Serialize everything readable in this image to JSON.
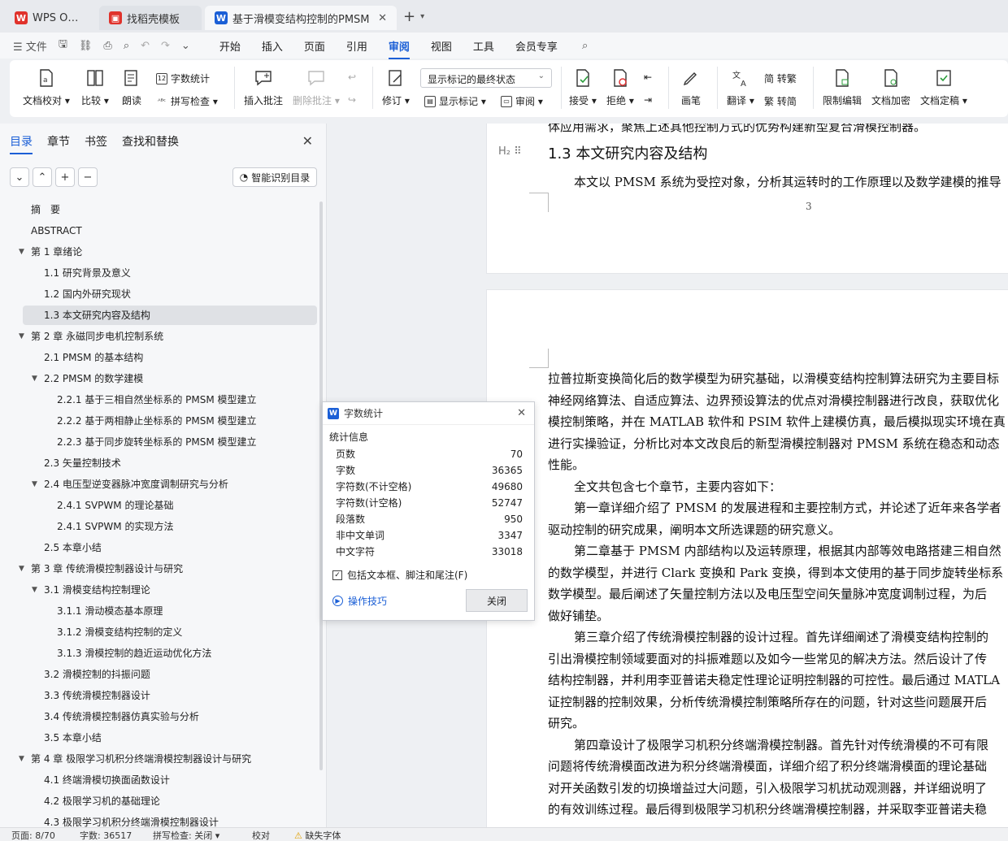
{
  "tabs": [
    {
      "label": "WPS Office",
      "color": "#e0322b"
    },
    {
      "label": "找稻壳模板",
      "color": "#e0322b"
    },
    {
      "label": "基于滑模变结构控制的PMSM",
      "color": "#1b5fd6"
    }
  ],
  "menu": {
    "file": "文件",
    "items": [
      "开始",
      "插入",
      "页面",
      "引用",
      "审阅",
      "视图",
      "工具",
      "会员专享"
    ],
    "active": "审阅"
  },
  "ribbon": {
    "doc_check": "文档校对",
    "compare": "比较",
    "read_aloud": "朗读",
    "word_count": "字数统计",
    "spell_check": "拼写检查",
    "insert_comment": "插入批注",
    "delete_comment": "删除批注",
    "revise": "修订",
    "markup_state": "显示标记的最终状态",
    "show_markup": "显示标记",
    "review": "审阅",
    "accept": "接受",
    "reject": "拒绝",
    "pen": "画笔",
    "translate": "翻译",
    "to_traditional": "简 转繁",
    "to_simplified": "繁 转简",
    "restrict_edit": "限制编辑",
    "encrypt": "文档加密",
    "finalize": "文档定稿"
  },
  "nav": {
    "tabs": [
      "目录",
      "章节",
      "书签",
      "查找和替换"
    ],
    "smart_toc": "智能识别目录",
    "toc": [
      {
        "label": "摘　要",
        "level": 0,
        "caret": false
      },
      {
        "label": "ABSTRACT",
        "level": 0,
        "caret": false
      },
      {
        "label": "第 1 章绪论",
        "level": 0,
        "caret": true
      },
      {
        "label": "1.1  研究背景及意义",
        "level": 1,
        "caret": false
      },
      {
        "label": "1.2  国内外研究现状",
        "level": 1,
        "caret": false
      },
      {
        "label": "1.3  本文研究内容及结构",
        "level": 1,
        "caret": false,
        "selected": true
      },
      {
        "label": "第 2 章  永磁同步电机控制系统",
        "level": 0,
        "caret": true
      },
      {
        "label": "2.1 PMSM 的基本结构",
        "level": 1,
        "caret": false
      },
      {
        "label": "2.2 PMSM 的数学建模",
        "level": 1,
        "caret": true
      },
      {
        "label": "2.2.1  基于三相自然坐标系的 PMSM 模型建立",
        "level": 2,
        "caret": false
      },
      {
        "label": "2.2.2  基于两相静止坐标系的 PMSM 模型建立",
        "level": 2,
        "caret": false
      },
      {
        "label": "2.2.3  基于同步旋转坐标系的 PMSM 模型建立",
        "level": 2,
        "caret": false
      },
      {
        "label": "2.3  矢量控制技术",
        "level": 1,
        "caret": false
      },
      {
        "label": "2.4  电压型逆变器脉冲宽度调制研究与分析",
        "level": 1,
        "caret": true
      },
      {
        "label": "2.4.1 SVPWM 的理论基础",
        "level": 2,
        "caret": false
      },
      {
        "label": "2.4.1 SVPWM 的实现方法",
        "level": 2,
        "caret": false
      },
      {
        "label": "2.5  本章小结",
        "level": 1,
        "caret": false
      },
      {
        "label": "第 3 章  传统滑模控制器设计与研究",
        "level": 0,
        "caret": true
      },
      {
        "label": "3.1  滑模变结构控制理论",
        "level": 1,
        "caret": true
      },
      {
        "label": "3.1.1  滑动模态基本原理",
        "level": 2,
        "caret": false
      },
      {
        "label": "3.1.2  滑模变结构控制的定义",
        "level": 2,
        "caret": false
      },
      {
        "label": "3.1.3  滑模控制的趋近运动优化方法",
        "level": 2,
        "caret": false
      },
      {
        "label": "3.2  滑模控制的抖振问题",
        "level": 1,
        "caret": false
      },
      {
        "label": "3.3  传统滑模控制器设计",
        "level": 1,
        "caret": false
      },
      {
        "label": "3.4  传统滑模控制器仿真实验与分析",
        "level": 1,
        "caret": false
      },
      {
        "label": "3.5  本章小结",
        "level": 1,
        "caret": false
      },
      {
        "label": "第 4 章  极限学习机积分终端滑模控制器设计与研究",
        "level": 0,
        "caret": true
      },
      {
        "label": "4.1  终端滑模切换面函数设计",
        "level": 1,
        "caret": false
      },
      {
        "label": "4.2  极限学习机的基础理论",
        "level": 1,
        "caret": false
      },
      {
        "label": "4.3  极限学习机积分终端滑模控制器设计",
        "level": 1,
        "caret": false
      }
    ]
  },
  "document": {
    "page1_top_line": "体应用需求，聚焦上述其他控制方式的优势构建新型复合滑模控制器。",
    "heading": "1.3  本文研究内容及结构",
    "page1_para": "本文以 PMSM 系统为受控对象，分析其运转时的工作原理以及数学建模的推导",
    "page_number": "3",
    "page2_lines": [
      "拉普拉斯变换简化后的数学模型为研究基础，以滑模变结构控制算法研究为主要目标",
      "神经网络算法、自适应算法、边界预设算法的优点对滑模控制器进行改良，获取优化",
      "模控制策略，并在 MATLAB 软件和 PSIM 软件上建模仿真，最后模拟现实环境在真",
      "进行实操验证，分析比对本文改良后的新型滑模控制器对 PMSM 系统在稳态和动态",
      "性能。",
      "全文共包含七个章节，主要内容如下：",
      "第一章详细介绍了 PMSM 的发展进程和主要控制方式，并论述了近年来各学者",
      "驱动控制的研究成果，阐明本文所选课题的研究意义。",
      "第二章基于 PMSM 内部结构以及运转原理，根据其内部等效电路搭建三相自然",
      "的数学模型，并进行 Clark 变换和 Park 变换，得到本文使用的基于同步旋转坐标系",
      "数学模型。最后阐述了矢量控制方法以及电压型空间矢量脉冲宽度调制过程，为后",
      "做好铺垫。",
      "第三章介绍了传统滑模控制器的设计过程。首先详细阐述了滑模变结构控制的",
      "引出滑模控制领域要面对的抖振难题以及如今一些常见的解决方法。然后设计了传",
      "结构控制器，并利用李亚普诺夫稳定性理论证明控制器的可控性。最后通过 MATLA",
      "证控制器的控制效果，分析传统滑模控制策略所存在的问题，针对这些问题展开后",
      "研究。",
      "第四章设计了极限学习机积分终端滑模控制器。首先针对传统滑模的不可有限",
      "问题将传统滑模面改进为积分终端滑模面，详细介绍了积分终端滑模面的理论基础",
      "对开关函数引发的切换增益过大问题，引入极限学习机扰动观测器，并详细说明了",
      "的有效训练过程。最后得到极限学习机积分终端滑模控制器，并采取李亚普诺夫稳"
    ],
    "indent_lines": [
      5,
      6,
      8,
      12,
      17
    ]
  },
  "word_count_dialog": {
    "title": "字数统计",
    "section": "统计信息",
    "stats": [
      {
        "label": "页数",
        "value": "70"
      },
      {
        "label": "字数",
        "value": "36365"
      },
      {
        "label": "字符数(不计空格)",
        "value": "49680"
      },
      {
        "label": "字符数(计空格)",
        "value": "52747"
      },
      {
        "label": "段落数",
        "value": "950"
      },
      {
        "label": "非中文单词",
        "value": "3347"
      },
      {
        "label": "中文字符",
        "value": "33018"
      }
    ],
    "include_label": "包括文本框、脚注和尾注(F)",
    "tips": "操作技巧",
    "close": "关闭"
  },
  "status": {
    "page": "页面: 8/70",
    "words": "字数: 36517",
    "spell": "拼写检查: 关闭",
    "proof": "校对",
    "missing_font": "缺失字体"
  },
  "colors": {
    "accent": "#1b5fd6",
    "wps_red": "#e0322b"
  }
}
